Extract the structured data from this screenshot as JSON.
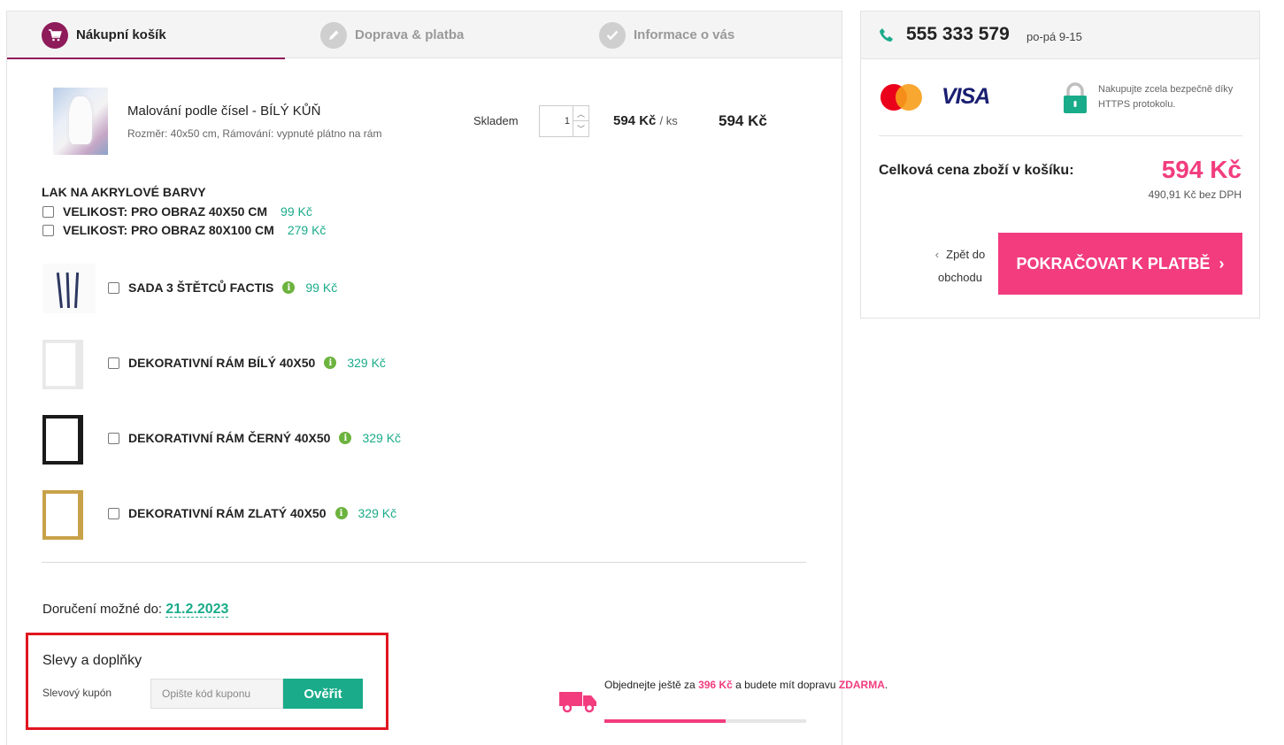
{
  "steps": [
    {
      "label": "Nákupní košík",
      "icon": "cart-icon"
    },
    {
      "label": "Doprava & platba",
      "icon": "pencil-icon"
    },
    {
      "label": "Informace o vás",
      "icon": "check-icon"
    }
  ],
  "product": {
    "name": "Malování podle čísel - BÍLÝ KŮŇ",
    "details": "Rozměr: 40x50 cm, Rámování: vypnuté plátno na rám",
    "stock": "Skladem",
    "quantity": "1",
    "unit_price": "594 Kč",
    "unit_suffix": "/ ks",
    "total_price": "594 Kč"
  },
  "varnish": {
    "title": "LAK NA AKRYLOVÉ BARVY",
    "options": [
      {
        "label": "VELIKOST: PRO OBRAZ 40X50 CM",
        "price": "99 Kč"
      },
      {
        "label": "VELIKOST: PRO OBRAZ 80X100 CM",
        "price": "279 Kč"
      }
    ]
  },
  "addons": [
    {
      "label": "SADA 3 ŠTĚTCŮ FACTIS",
      "price": "99 Kč"
    },
    {
      "label": "DEKORATIVNÍ RÁM BÍLÝ 40X50",
      "price": "329 Kč"
    },
    {
      "label": "DEKORATIVNÍ RÁM ČERNÝ 40X50",
      "price": "329 Kč"
    },
    {
      "label": "DEKORATIVNÍ RÁM ZLATÝ 40X50",
      "price": "329 Kč"
    }
  ],
  "delivery": {
    "label": "Doručení možné do:",
    "date": "21.2.2023"
  },
  "discounts": {
    "title": "Slevy a doplňky",
    "coupon_label": "Slevový kupón",
    "coupon_placeholder": "Opište kód kuponu",
    "verify_button": "Ověřit"
  },
  "shipping": {
    "text_before": "Objednejte ještě za",
    "amount": "396 Kč",
    "text_middle": "a budete mít dopravu",
    "free": "ZDARMA",
    "text_end": ".",
    "progress": 0.6
  },
  "sidebar": {
    "phone": "555 333 579",
    "hours": "po-pá 9-15",
    "secure_text": "Nakupujte zcela bezpečně díky HTTPS protokolu.",
    "visa": "VISA",
    "total_label": "Celková cena zboží v košíku:",
    "total_price": "594 Kč",
    "total_net": "490,91 Kč bez DPH",
    "back_label": "Zpět do obchodu",
    "continue_label": "POKRAČOVAT K PLATBĚ"
  },
  "colors": {
    "brand": "#8e1b5a",
    "accent": "#f23c7e",
    "teal": "#1aab8a",
    "highlight_box": "#e0161f"
  }
}
